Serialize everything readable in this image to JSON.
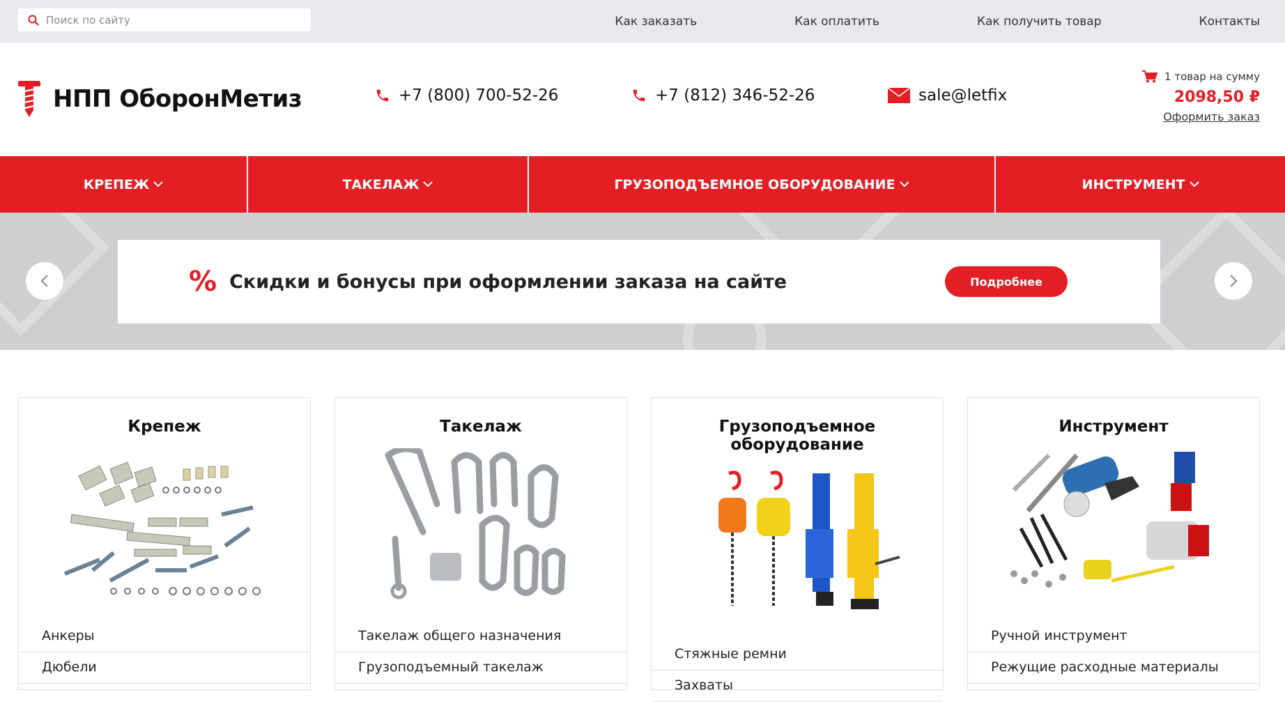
{
  "topbar": {
    "search_placeholder": "Поиск по сайту",
    "links": [
      "Как заказать",
      "Как оплатить",
      "Как получить товар",
      "Контакты"
    ]
  },
  "header": {
    "logo_text": "НПП ОборонМетиз",
    "phone1": "+7 (800) 700-52-26",
    "phone2": "+7 (812) 346-52-26",
    "email": "sale@letfix",
    "cart_summary": "1 товар на сумму",
    "cart_total": "2098,50 ₽",
    "checkout_link": "Оформить заказ"
  },
  "nav": {
    "items": [
      "КРЕПЕЖ",
      "ТАКЕЛАЖ",
      "ГРУЗОПОДЪЕМНОЕ ОБОРУДОВАНИЕ",
      "ИНСТРУМЕНТ"
    ]
  },
  "banner": {
    "icon": "%",
    "text": "Скидки и бонусы при оформлении заказа на сайте",
    "button": "Подробнее"
  },
  "categories": [
    {
      "title": "Крепеж",
      "links": [
        "Анкеры",
        "Дюбели"
      ]
    },
    {
      "title": "Такелаж",
      "links": [
        "Такелаж общего назначения",
        "Грузоподъемный такелаж"
      ]
    },
    {
      "title": "Грузоподъемное оборудование",
      "links": [
        "Стяжные ремни",
        "Захваты"
      ]
    },
    {
      "title": "Инструмент",
      "links": [
        "Ручной инструмент",
        "Режущие расходные материалы"
      ]
    }
  ],
  "colors": {
    "accent": "#e31e24",
    "topbar_bg": "#e8e9ec",
    "banner_bg": "#cfcfd1"
  }
}
